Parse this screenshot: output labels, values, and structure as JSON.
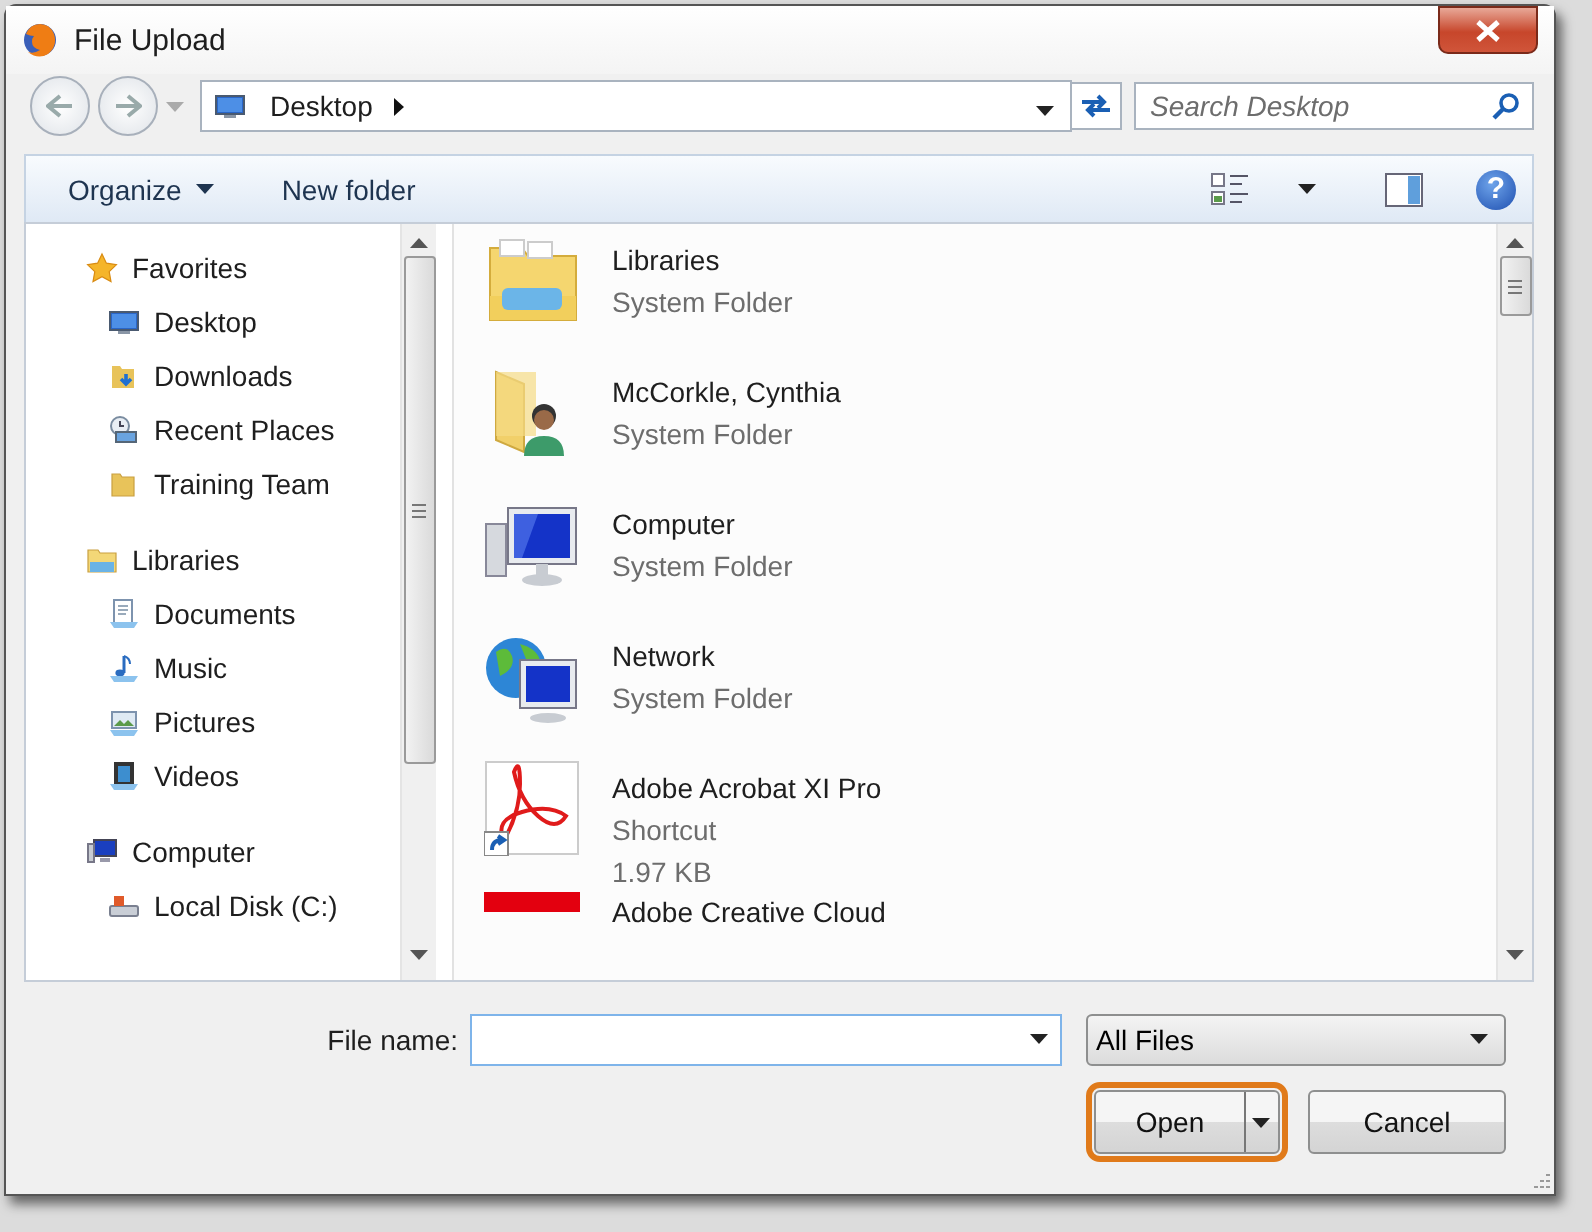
{
  "window": {
    "title": "File Upload"
  },
  "address_bar": {
    "location": "Desktop"
  },
  "search": {
    "placeholder": "Search Desktop"
  },
  "toolbar": {
    "organize": "Organize",
    "new_folder": "New folder",
    "help": "?"
  },
  "navigation": [
    {
      "label": "Favorites",
      "kind": "favorites",
      "children": [
        {
          "label": "Desktop",
          "kind": "desktop"
        },
        {
          "label": "Downloads",
          "kind": "downloads"
        },
        {
          "label": "Recent Places",
          "kind": "recent"
        },
        {
          "label": "Training Team",
          "kind": "folder"
        }
      ]
    },
    {
      "label": "Libraries",
      "kind": "libraries",
      "children": [
        {
          "label": "Documents",
          "kind": "documents"
        },
        {
          "label": "Music",
          "kind": "music"
        },
        {
          "label": "Pictures",
          "kind": "pictures"
        },
        {
          "label": "Videos",
          "kind": "videos"
        }
      ]
    },
    {
      "label": "Computer",
      "kind": "computer",
      "children": [
        {
          "label": "Local Disk (C:)",
          "kind": "disk"
        }
      ]
    }
  ],
  "files": [
    {
      "name": "Libraries",
      "type": "System Folder",
      "kind": "libraries"
    },
    {
      "name": "McCorkle, Cynthia",
      "type": "System Folder",
      "kind": "user"
    },
    {
      "name": "Computer",
      "type": "System Folder",
      "kind": "computer"
    },
    {
      "name": "Network",
      "type": "System Folder",
      "kind": "network"
    },
    {
      "name": "Adobe Acrobat XI Pro",
      "type": "Shortcut",
      "size": "1.97 KB",
      "kind": "pdf"
    },
    {
      "name": "Adobe Creative Cloud",
      "kind": "app"
    }
  ],
  "file_name": {
    "label": "File name:"
  },
  "file_type": {
    "value": "All Files"
  },
  "buttons": [
    {
      "label": "Open",
      "kind": "split",
      "highlighted": true
    },
    {
      "label": "Cancel",
      "kind": "plain",
      "highlighted": false
    }
  ]
}
